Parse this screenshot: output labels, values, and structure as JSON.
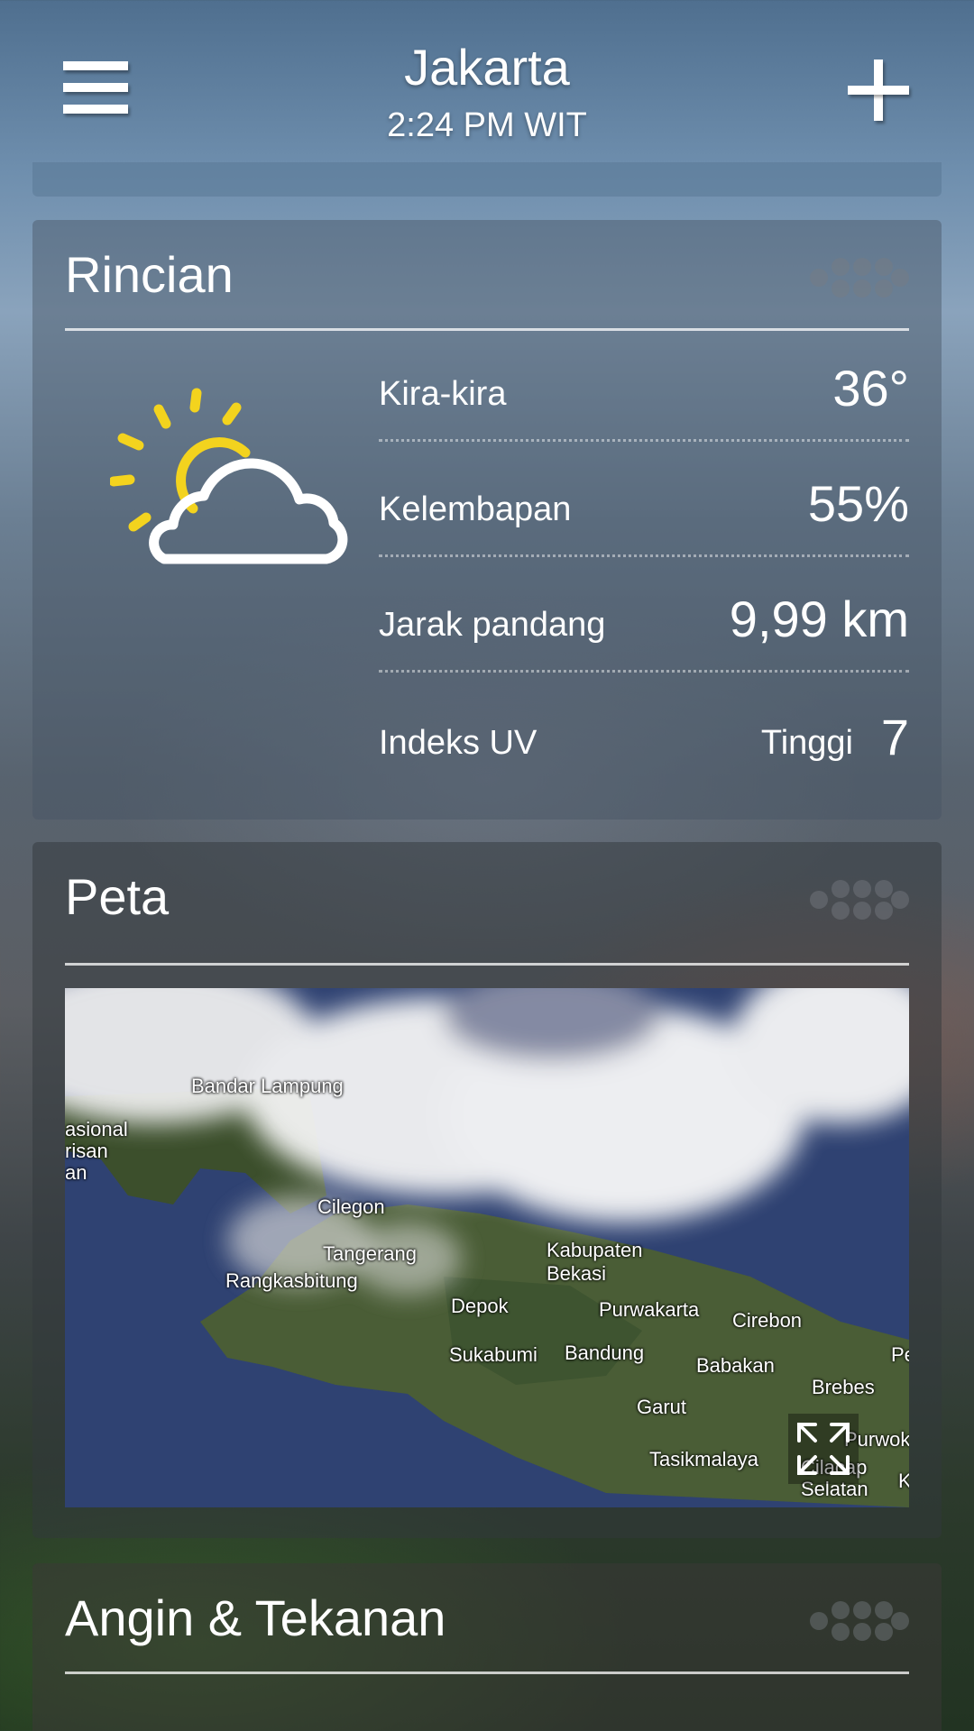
{
  "header": {
    "city": "Jakarta",
    "time": "2:24 PM WIT",
    "menu_icon": "menu-icon",
    "add_icon": "plus-icon"
  },
  "details": {
    "title": "Rincian",
    "weather_icon": "partly-cloudy-icon",
    "rows": [
      {
        "label": "Kira-kira",
        "value": "36°"
      },
      {
        "label": "Kelembapan",
        "value": "55%"
      },
      {
        "label": "Jarak pandang",
        "value": "9,99 km"
      },
      {
        "label": "Indeks UV",
        "sub": "Tinggi",
        "value": "7"
      }
    ]
  },
  "map": {
    "title": "Peta",
    "places": [
      "Bandar Lampung",
      "asional",
      "risan",
      "an",
      "Cilegon",
      "Tangerang",
      "Kabupaten Bekasi",
      "Rangkasbitung",
      "Depok",
      "Purwakarta",
      "Cirebon",
      "Sukabumi",
      "Bandung",
      "Babakan",
      "Brebes",
      "Garut",
      "Purwoke",
      "Tasikmalaya",
      "Cilacap Selatan",
      "Pe",
      "K"
    ]
  },
  "wind": {
    "title": "Angin & Tekanan"
  },
  "colors": {
    "sun": "#f3d31e",
    "text": "#ffffff"
  }
}
